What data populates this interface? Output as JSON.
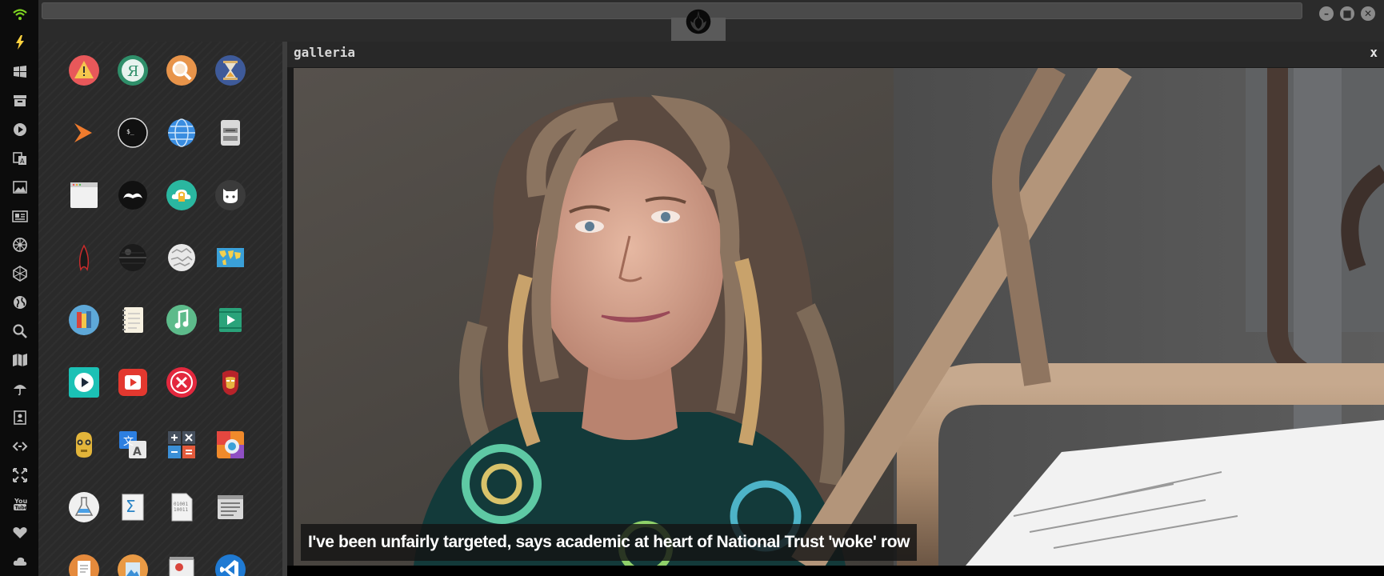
{
  "window": {
    "address_value": "",
    "controls": [
      "minimize",
      "maximize",
      "close"
    ]
  },
  "dock": {
    "icons": [
      "wifi-icon",
      "power-bolt-icon",
      "windows-icon",
      "archive-icon",
      "play-icon",
      "translate-icon",
      "image-icon",
      "news-icon",
      "empire-icon",
      "hexagon-icon",
      "globe-icon",
      "search-icon",
      "map-icon",
      "umbrella-icon",
      "contacts-icon",
      "code-icon",
      "fullscreen-icon",
      "youtube-icon",
      "heart-icon",
      "cloud-icon"
    ]
  },
  "apps": [
    "warning-icon",
    "yandex-icon",
    "magnifier-icon",
    "hourglass-icon",
    "forward-icon",
    "terminal-icon",
    "globe-browser-icon",
    "drive-icon",
    "browser-window-icon",
    "mustache-icon",
    "cloud-lock-icon",
    "github-icon",
    "starfleet-icon",
    "death-star-icon",
    "wikipedia-icon",
    "world-map-icon",
    "books-icon",
    "notebook-icon",
    "music-icon",
    "video-icon",
    "play-button-icon",
    "red-play-icon",
    "close-circle-icon",
    "iron-man-icon",
    "c3po-icon",
    "translate-app-icon",
    "calculator-icon",
    "color-window-icon",
    "flask-icon",
    "sigma-icon",
    "binary-file-icon",
    "text-editor-icon",
    "document-icon",
    "photo-icon",
    "presentation-icon",
    "vscode-icon"
  ],
  "galleria": {
    "title": "galleria",
    "close": "x",
    "caption": "I've been unfairly targeted, says academic at heart of National Trust 'woke' row"
  },
  "colors": {
    "dock_bg": "#0c0c0c",
    "panel_bg": "#2a2a2a",
    "topbar_bg": "#2b2b2b",
    "accent_green": "#7ed321",
    "accent_yellow": "#ffd23f"
  }
}
